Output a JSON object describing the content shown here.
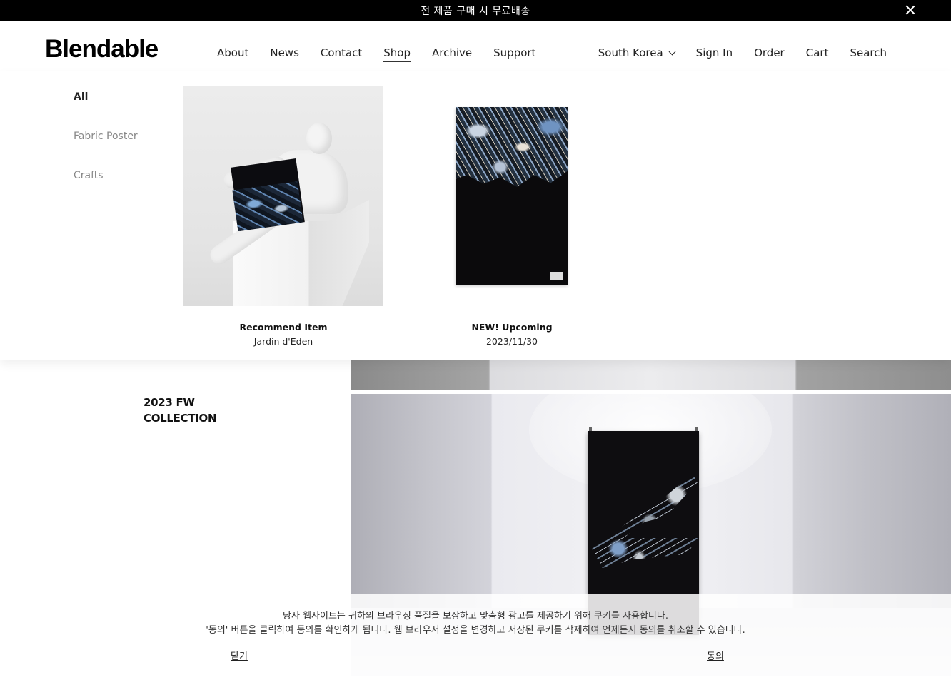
{
  "announcement": {
    "text": "전 제품 구매 시 무료배송",
    "close_icon": "close-icon"
  },
  "header": {
    "logo": "Blendable",
    "nav_left": [
      "About",
      "News",
      "Contact",
      "Shop",
      "Archive",
      "Support"
    ],
    "active_nav": "Shop",
    "region": "South Korea",
    "nav_right": [
      "Sign In",
      "Order",
      "Cart",
      "Search"
    ]
  },
  "mega_menu": {
    "categories": [
      "All",
      "Fabric Poster",
      "Crafts"
    ],
    "active_category": "All",
    "cards": [
      {
        "title": "Recommend Item",
        "subtitle": "Jardin d'Eden"
      },
      {
        "title": "NEW! Upcoming",
        "subtitle": "2023/11/30"
      }
    ]
  },
  "main": {
    "collection_line1": "2023 FW",
    "collection_line2": "COLLECTION"
  },
  "cookie": {
    "line1": "당사 웹사이트는 귀하의 브라우징 품질을 보장하고 맞춤형 광고를 제공하기 위해 쿠키를 사용합니다.",
    "line2": "'동의' 버튼을 클릭하여 동의를 확인하게 됩니다. 웹 브라우저 설정을 변경하고 저장된 쿠키를 삭제하여 언제든지 동의를 취소할 수 있습니다.",
    "close_label": "닫기",
    "agree_label": "동의"
  }
}
